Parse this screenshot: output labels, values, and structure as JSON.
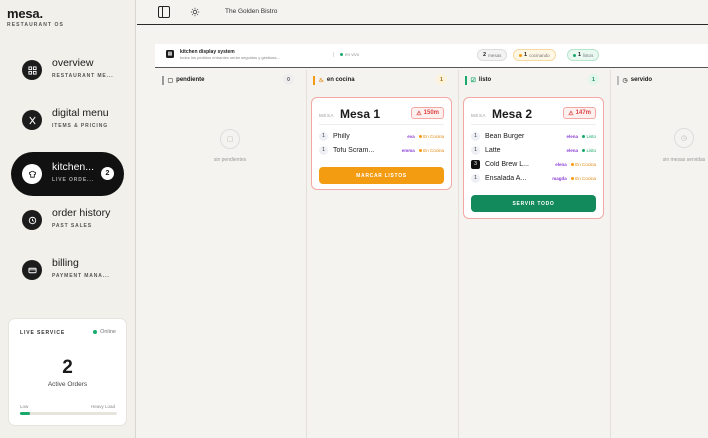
{
  "brand": {
    "name": "mesa.",
    "subtitle": "RESTAURANT OS"
  },
  "nav": [
    {
      "title": "overview",
      "sub": "RESTAURANT ME...",
      "icon": "grid-icon"
    },
    {
      "title": "digital menu",
      "sub": "ITEMS & PRICING",
      "icon": "utensils-icon"
    },
    {
      "title": "kitchen...",
      "sub": "LIVE ORDE...",
      "icon": "chef-hat-icon",
      "badge": "2",
      "active": true
    },
    {
      "title": "order history",
      "sub": "PAST SALES",
      "icon": "history-icon"
    },
    {
      "title": "billing",
      "sub": "PAYMENT MANA...",
      "icon": "credit-card-icon"
    }
  ],
  "live_service": {
    "label": "LIVE SERVICE",
    "status": "Online",
    "count": "2",
    "caption": "Active Orders",
    "low_label": "Low",
    "high_label": "Heavy Load",
    "load_fraction": 0.1
  },
  "topbar": {
    "restaurant": "The Golden Bistro"
  },
  "kds": {
    "title": "kitchen display system",
    "description": "todos los pedidos entrantes serán seguidos y gestiona...",
    "live": "en vivo",
    "pills": {
      "mesas": {
        "count": "2",
        "label": "mesas"
      },
      "cocinando": {
        "count": "1",
        "label": "cocinando"
      },
      "listos": {
        "count": "1",
        "label": "listos"
      }
    }
  },
  "columns": {
    "pendiente": {
      "label": "pendiente",
      "count": "0",
      "empty": "sin pendientes"
    },
    "cocina": {
      "label": "en cocina",
      "count": "1"
    },
    "listo": {
      "label": "listo",
      "count": "1"
    },
    "servido": {
      "label": "servido",
      "empty": "sin mesas servidas"
    }
  },
  "cards": {
    "mesa1": {
      "mesa_label": "MESA",
      "mesa_num": "Mesa 1",
      "time": "150m",
      "items": [
        {
          "qty": "1",
          "name": "Philly",
          "user": "eva",
          "status": "En Cocina"
        },
        {
          "qty": "1",
          "name": "Tofu Scram...",
          "user": "emma",
          "status": "En Cocina"
        }
      ],
      "button": "MARCAR LISTOS"
    },
    "mesa2": {
      "mesa_label": "MESA",
      "mesa_num": "Mesa 2",
      "time": "147m",
      "items": [
        {
          "qty": "1",
          "name": "Bean Burger",
          "user": "elena",
          "status": "Listo"
        },
        {
          "qty": "1",
          "name": "Latte",
          "user": "elena",
          "status": "Listo"
        },
        {
          "qty": "3",
          "name": "Cold Brew L...",
          "user": "elena",
          "status": "En Cocina"
        },
        {
          "qty": "1",
          "name": "Ensalada A...",
          "user": "magda",
          "status": "En Cocina"
        }
      ],
      "button": "SERVIR TODO"
    }
  },
  "colors": {
    "accent_orange": "#f39c12",
    "accent_green": "#128a5c",
    "alert_red": "#d44444",
    "user_purple": "#8b3fd6"
  }
}
